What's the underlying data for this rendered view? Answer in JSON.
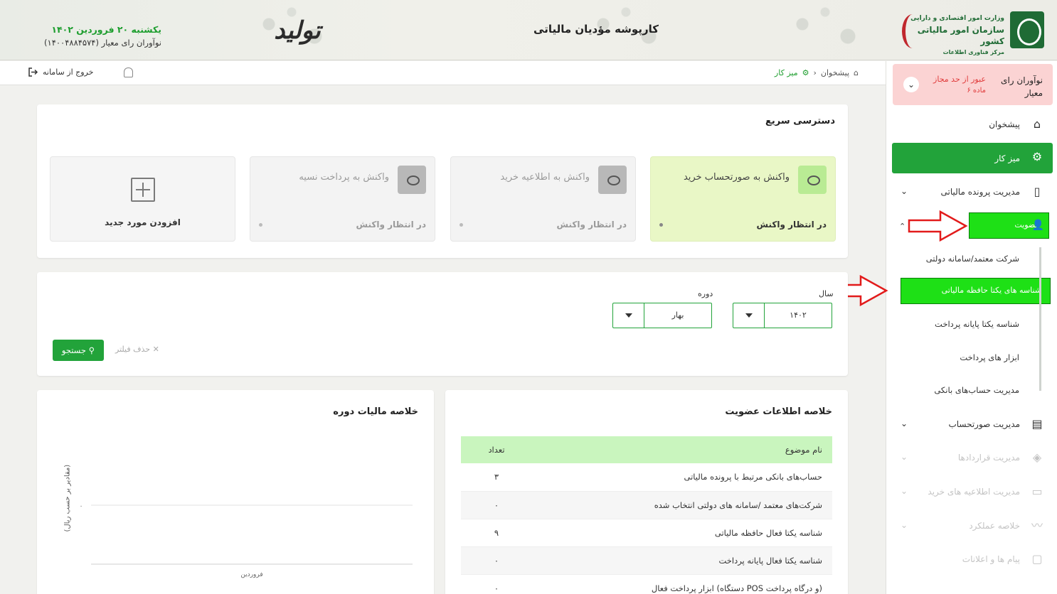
{
  "header": {
    "app_title": "کارپوشه مؤدیان مالیاتی",
    "org_line1": "وزارت امور اقتصادی و دارایی",
    "org_line2": "سازمان امور مالیاتی کشور",
    "org_line3": "مرکز فناوری اطلاعات",
    "calligraphy": "تولید",
    "date": "یکشنبه ۲۰ فروردین ۱۴۰۲",
    "user": "نوآوران رای معیار (۱۴۰۰۴۸۸۴۵۷۴)"
  },
  "toolbar": {
    "logout": "خروج از سامانه",
    "breadcrumb_home": "پیشخوان",
    "breadcrumb_current": "میز کار"
  },
  "sidebar": {
    "user_name": "نوآوران رای معیار",
    "warning": "عبور از حد مجاز",
    "warning_sub": "۶ ماده",
    "items": [
      {
        "label": "پیشخوان"
      },
      {
        "label": "میز کار"
      },
      {
        "label": "مدیریت پرونده مالیاتی"
      },
      {
        "label": "عضویت"
      },
      {
        "label": "مدیریت صورتحساب"
      },
      {
        "label": "مدیریت قراردادها"
      },
      {
        "label": "مدیریت اطلاعیه های خرید"
      },
      {
        "label": "خلاصه عملکرد"
      },
      {
        "label": "پیام ها و اعلانات"
      }
    ],
    "sub_items": [
      {
        "label": "شرکت معتمد/سامانه دولتی"
      },
      {
        "label": "شناسه های یکتا حافظه مالیاتی"
      },
      {
        "label": "شناسه یکتا پایانه پرداخت"
      },
      {
        "label": "ابزار های پرداخت"
      },
      {
        "label": "مدیریت حساب‌های بانکی"
      }
    ]
  },
  "quick_access": {
    "title": "دسترسی سریع",
    "cards": [
      {
        "title": "واکنش به صورتحساب خرید",
        "status": "در انتظار واکنش",
        "count": "۰"
      },
      {
        "title": "واکنش به اطلاعیه خرید",
        "status": "در انتظار واکنش",
        "count": "۰"
      },
      {
        "title": "واکنش به پرداخت نسیه",
        "status": "در انتظار واکنش",
        "count": "۰"
      }
    ],
    "add_label": "افزودن مورد جدید"
  },
  "filter": {
    "year_label": "سال",
    "year_value": "۱۴۰۲",
    "period_label": "دوره",
    "period_value": "بهار",
    "clear_label": "حذف فیلتر",
    "search_label": "جستجو"
  },
  "membership": {
    "title": "خلاصه اطلاعات عضویت",
    "headers": [
      "نام موضوع",
      "تعداد"
    ],
    "rows": [
      {
        "subject": "حساب‌های بانکی مرتبط با پرونده مالیاتی",
        "count": "۳"
      },
      {
        "subject": "شرکت‌های معتمد /سامانه های دولتی انتخاب شده",
        "count": "۰"
      },
      {
        "subject": "شناسه یکتا فعال حافظه مالیاتی",
        "count": "۹"
      },
      {
        "subject": "شناسه یکتا فعال پایانه پرداخت",
        "count": "۰"
      },
      {
        "subject": "ابزار پرداخت فعال (دستگاه POS و درگاه پرداخت)",
        "count": "۰"
      }
    ]
  },
  "tax_summary": {
    "title": "خلاصه مالیات دوره"
  },
  "chart_data": {
    "type": "bar",
    "title": "خلاصه مالیات دوره",
    "categories": [
      "فروردین"
    ],
    "values": [
      0
    ],
    "xlabel": "",
    "ylabel": "(مقادیر بر حسب ریال)",
    "yticks": [
      "۰"
    ],
    "grid": true
  }
}
